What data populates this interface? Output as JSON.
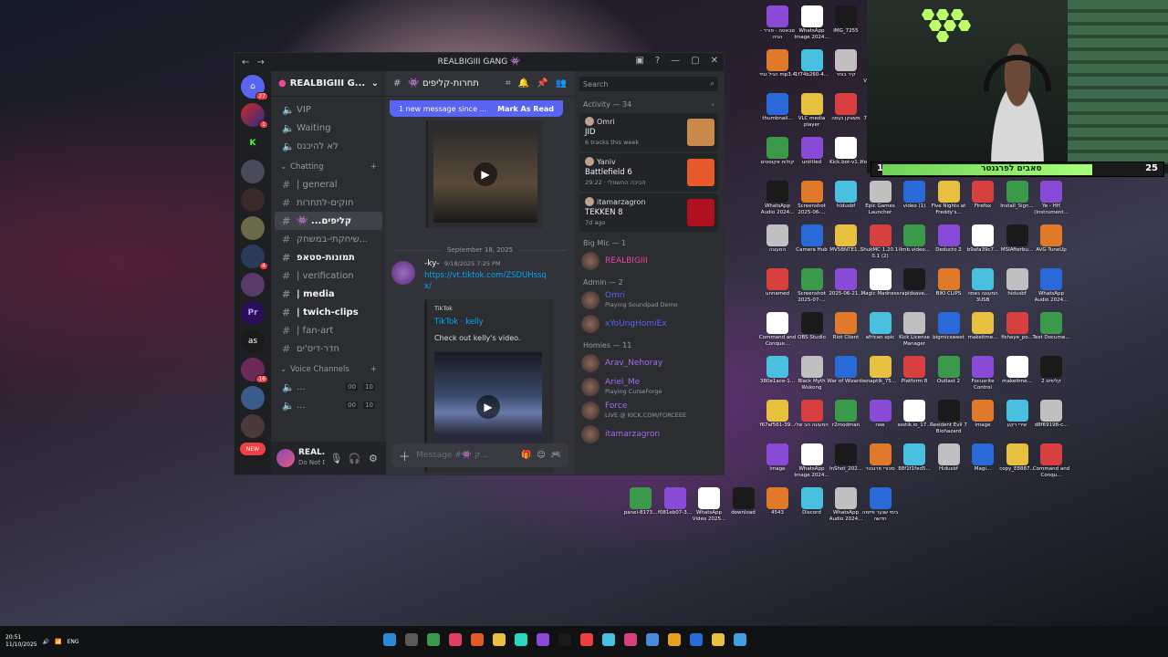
{
  "window": {
    "title": "REALBIGIII GANG 👾"
  },
  "server": {
    "name": "REALBIGIII G..."
  },
  "rail_badges": [
    "27",
    "1",
    "4",
    "16"
  ],
  "rail_label": "Pr",
  "rail_as": "as",
  "rail_new": "NEW",
  "channels": [
    {
      "name": "VIP",
      "type": "voice"
    },
    {
      "name": "Waiting",
      "type": "voice"
    },
    {
      "name": "לא להיכנס",
      "type": "voice"
    }
  ],
  "category_chatting": "Chatting",
  "text_channels": [
    {
      "name": "| general",
      "active": false,
      "bold": false
    },
    {
      "name": "חוקים-לתחרות",
      "active": false,
      "bold": false
    },
    {
      "name": "👾 ...קליפים",
      "active": true,
      "bold": true
    },
    {
      "name": "שיחקתי-במשחק...",
      "active": false,
      "bold": false
    },
    {
      "name": "תמונות-סטאפ",
      "active": false,
      "bold": true
    },
    {
      "name": "| verification",
      "active": false,
      "bold": false
    },
    {
      "name": "| media",
      "active": false,
      "bold": true
    },
    {
      "name": "| twich-clips",
      "active": false,
      "bold": true
    },
    {
      "name": "| fan-art",
      "active": false,
      "bold": false
    },
    {
      "name": "חדר-דיס'ים",
      "active": false,
      "bold": false
    }
  ],
  "category_voice": "Voice Channels",
  "voice_rows": [
    {
      "name": "...",
      "a": "00",
      "b": "10"
    },
    {
      "name": "...",
      "a": "00",
      "b": "10"
    }
  ],
  "user": {
    "name": "REAL...",
    "status": "Do Not Di..."
  },
  "chat": {
    "channel": "👾 תחרות-קליפים",
    "new_banner": "1 new message since ...",
    "mark_read": "Mark As Read",
    "date": "September 18, 2025",
    "author": "-ky-",
    "time": "9/18/2025 7:25 PM",
    "link": "https://vt.tiktok.com/ZSDUHssqx/",
    "embed_provider": "TikTok",
    "embed_title": "TikTok · kelly",
    "embed_desc": "Check out kelly's video.",
    "composer_placeholder": "Message #👾 ק..."
  },
  "members": {
    "search_placeholder": "Search",
    "activity_header": "Activity — 34",
    "activities": [
      {
        "user": "Omri",
        "game": "JID",
        "sub": "6 tracks this week",
        "color": "#c88a4a"
      },
      {
        "user": "Yaniv",
        "game": "Battlefield 6",
        "sub": "29:22 · הכיכה החשמלי",
        "color": "#e85a2a"
      },
      {
        "user": "itamarzagron",
        "game": "TEKKEN 8",
        "sub": "7d ago",
        "color": "#b01020"
      }
    ],
    "groups": [
      {
        "title": "Big Mic — 1",
        "members": [
          {
            "name": "REALBIGIII",
            "status": "",
            "color": "#eb459e"
          }
        ]
      },
      {
        "title": "Admin — 2",
        "members": [
          {
            "name": "Omri",
            "status": "Playing Soundpad Demo",
            "color": "#5865f2"
          },
          {
            "name": "xYoUngHomiEx",
            "status": "",
            "color": "#5865f2"
          }
        ]
      },
      {
        "title": "Homies — 11",
        "members": [
          {
            "name": "Arav_Nehoray",
            "status": "",
            "color": "#a36df0"
          },
          {
            "name": "Ariel_Me",
            "status": "Playing CurseForge",
            "color": "#a36df0"
          },
          {
            "name": "Force",
            "status": "LIVE @ KICK.COM/FORCEEE",
            "color": "#a36df0"
          },
          {
            "name": "itamarzagron",
            "status": "",
            "color": "#a36df0"
          }
        ]
      }
    ]
  },
  "stream_overlay": {
    "left": "19",
    "right": "25",
    "name": "סאבים לפרגנטר"
  },
  "desktop_icons": [
    "Getting Over It with Ben...",
    "VIDEO-202...",
    "Nitrox_1.7.1.0",
    "קיר בוחר צעדים",
    "סבאסה - פורר - הגיה",
    "WhatsApp Image 2024...",
    "IMG_7255",
    "",
    "",
    "Oracle VM VirtualBox",
    "Steam",
    "MSI Afterburner",
    "Auto-Tune Central",
    "Setup - קיצור דרך",
    "0x5H6OuA...",
    "0",
    "Surfshark",
    "הגיל נגיד mp3.4",
    "1f74b260-4...",
    "קיר בוחר",
    "WhatsApp Video 2025...",
    "תמונות אלגוריתם",
    "ASIOALL Web Site",
    "Vortex",
    "YeToiQFhu...",
    "WhatsApp Video 2025...",
    "לא עובד",
    "Google Chrome",
    "3268c304-b...",
    "image",
    "thumbnail...",
    "VLC media player",
    "משאקן נעמה",
    "7eb6ec8d7...",
    "sekiro",
    "Nitrox_1.7.1.0",
    "walpaper",
    "dbb2e9fe-7...",
    "8fe1106-f8...",
    "OptiFine_1...",
    "1-2908a140",
    "Nightcrawler - travis sco...",
    "0f014648-1...",
    "קולות אקוסטים",
    "untitled",
    "Kick.bot-v1...",
    "Honkai Star Rail",
    "שירי אוקטובר",
    "PRIME-Z79...",
    "giphy",
    "Install iCUE (1)",
    "WhatsApp Image 2025...",
    "TreeSize Free",
    "975cd1ba-...",
    "2025-04-25 20-48-17 (2)",
    "3595a683-8...",
    "WhatsApp Audio 2024...",
    "Screenshot 2025-06-...",
    "hidusbf",
    "Epic Games Launcher",
    "video (1)",
    "Five Nights at Freddy's...",
    "Firefox",
    "Install_Sign...",
    "Ye - HH (Instrument...",
    "LOCKDOWN Protocol",
    "all gas, no brakes hom...",
    "הכוח זיכה",
    "Elgato Camera Hub",
    "המעוגה",
    "Camera Hub",
    "MV5BNTE1...",
    "ShukMC 1.20.1-0.1 (2)",
    "llmb.video...",
    "Deducto 2",
    "b9afa39c7...",
    "MSIAfterbu...",
    "AVG TuneUp",
    "6746ab06-f...",
    "LetsView",
    "11e7e8b2-4...",
    "almog bits",
    "unnamed",
    "Screenshot 2025-07-...",
    "2025-06-21...",
    "Magic Madness",
    "rapidsave...",
    "BIKI CLIPS",
    "המעוגה נשמה 3USB",
    "hidusbf",
    "WhatsApp Audio 2024...",
    "1b5e1f31-7...",
    "Ronen Bertit",
    "SteamVR",
    "e74f73ab-0...",
    "Command and Conque...",
    "OBS Studio",
    "Riot Client",
    "african spic",
    "Kick License Manager",
    "bigmicsweet",
    "makeitme...",
    "fisheye_po...",
    "Text Docume...",
    "Stream Deck",
    "Todoist",
    "סל המחזור",
    "9fe6ba35-6...",
    "380e1ace-1...",
    "Black Myth Wukong",
    "War of Wizards",
    "snaptik_75...",
    "Platform 8",
    "Outlast 2",
    "Focusrite Control",
    "makeitme...",
    "קליפים 2",
    "674443b6-f...",
    "Rockstar Games...",
    "CopyTrans Control Center",
    "WhatsApp Video 2024...",
    "f67af561-39...",
    "המעוגה הב שלי",
    "r2modman",
    "raw",
    "ssstik.io_17...",
    "Resident Evil 7 Biohazard",
    "image",
    "שירי רקע",
    "d8f69198-c...",
    "bigmicmoon",
    "Meta Quest Link",
    "NVIDIA Broadcast",
    "clips",
    "image",
    "WhatsApp Image 2024...",
    "InShot_202...",
    "סטורי פרגנטר",
    "88f1f1fed5...",
    "Hidusbf",
    "Magi...",
    "copy_E8887...",
    "Command and Conqu...",
    "panel-8173...",
    "f081eb07-3...",
    "WhatsApp Video 2025...",
    "download",
    "4543",
    "Discord",
    "WhatsApp Audio 2024...",
    "בימי שנער פיזמה חדשה"
  ],
  "taskbar": {
    "time": "20:51",
    "date": "11/10/2025",
    "lang": "ENG"
  }
}
